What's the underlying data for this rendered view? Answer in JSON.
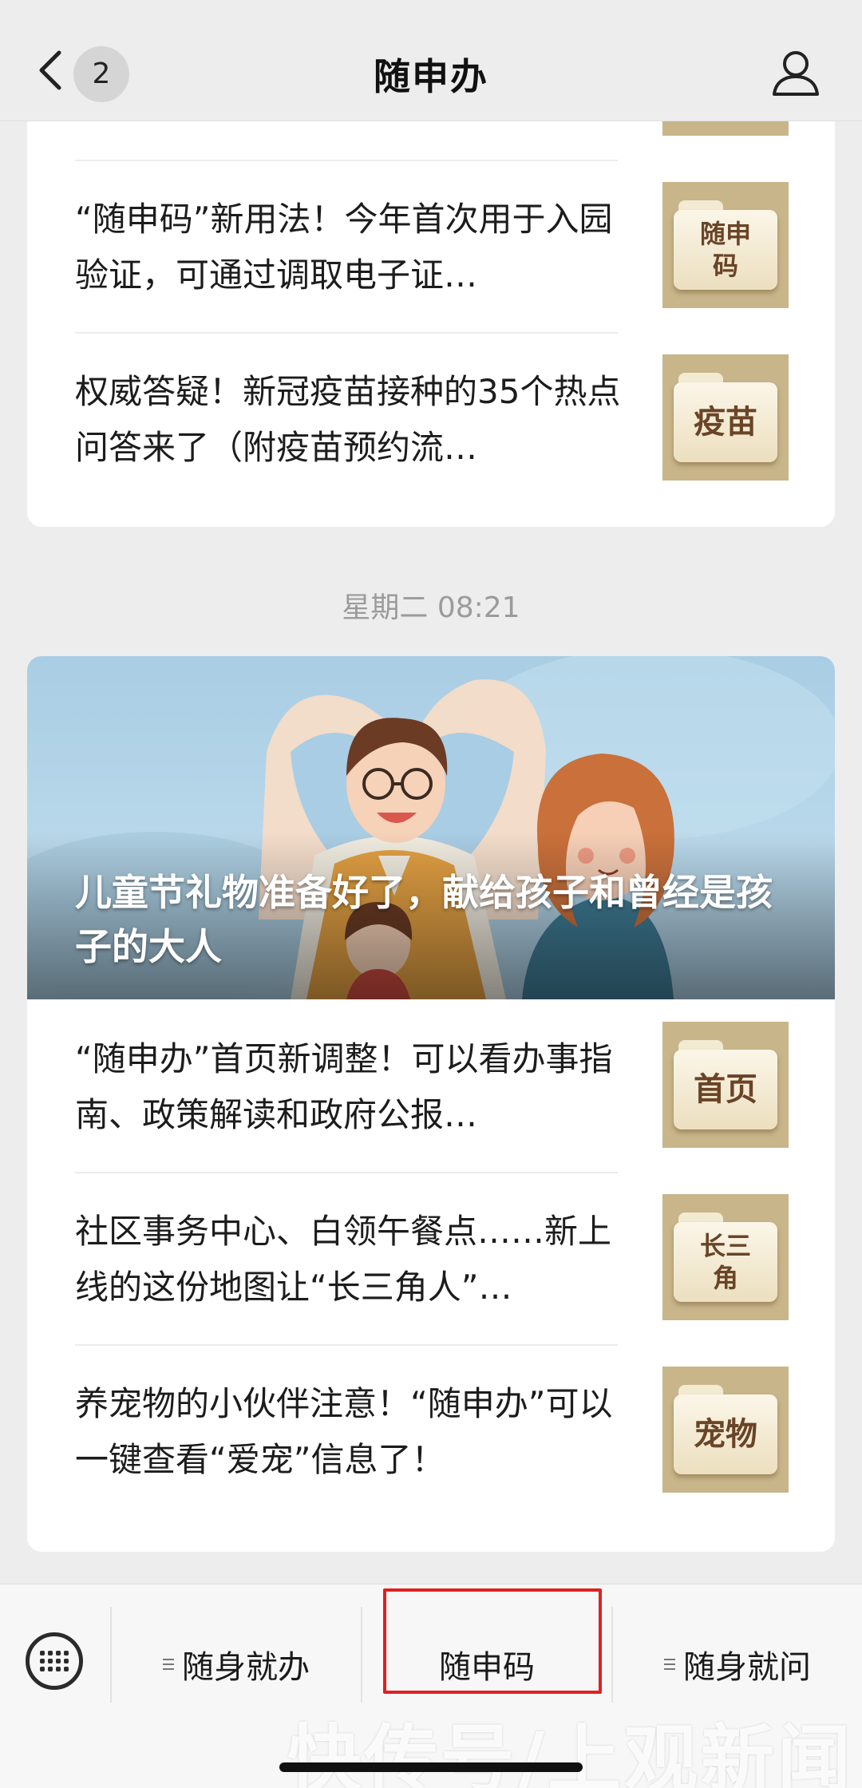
{
  "header": {
    "title": "随申办",
    "unread_count": "2"
  },
  "feed": {
    "group1": {
      "articles": [
        {
          "title": "“随申码”新用法！今年首次用于入园验证，可通过调取电子证…",
          "thumb_label": "随申码"
        },
        {
          "title": "权威答疑！新冠疫苗接种的35个热点问答来了（附疫苗预约流…",
          "thumb_label": "疫苗"
        }
      ]
    },
    "timestamp": "星期二 08:21",
    "group2": {
      "hero_title": "儿童节礼物准备好了，献给孩子和曾经是孩子的大人",
      "articles": [
        {
          "title": "“随申办”首页新调整！可以看办事指南、政策解读和政府公报…",
          "thumb_label": "首页"
        },
        {
          "title": "社区事务中心、白领午餐点……新上线的这份地图让“长三角人”…",
          "thumb_label": "长三角"
        },
        {
          "title": "养宠物的小伙伴注意！“随申办”可以一键查看“爱宠”信息了！",
          "thumb_label": "宠物"
        }
      ]
    }
  },
  "bottom_menu": {
    "items": [
      {
        "label": "随身就办",
        "has_submenu": true
      },
      {
        "label": "随申码",
        "has_submenu": false,
        "highlighted": true
      },
      {
        "label": "随身就问",
        "has_submenu": true
      }
    ]
  },
  "watermark": "快传号/上观新闻",
  "colors": {
    "background": "#ededed",
    "thumb_bg": "#c8b58a",
    "folder_text": "#6a4427",
    "highlight": "#e02020"
  },
  "icons": [
    "back-chevron-icon",
    "profile-icon",
    "keyboard-icon",
    "menu-lines-icon",
    "folder-icon"
  ]
}
